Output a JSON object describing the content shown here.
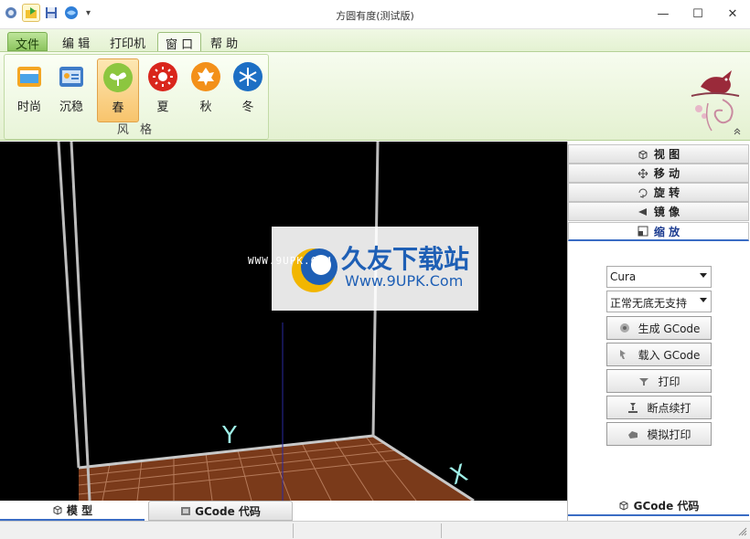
{
  "window": {
    "title": "方圆有度(测试版)",
    "minimize": "—",
    "maximize": "☐",
    "close": "✕"
  },
  "qat": {
    "customize": "▾"
  },
  "ribbon_tabs": [
    "文件",
    "编 辑",
    "打印机",
    "窗 口",
    "帮 助"
  ],
  "style_group": {
    "label": "风 格",
    "buttons": [
      "时尚",
      "沉稳",
      "春",
      "夏",
      "秋",
      "冬"
    ],
    "selected": "春"
  },
  "viewport": {
    "axis_y": "Y",
    "axis_x": "X",
    "watermark_url": "WWW.9UPK.COM",
    "watermark_brand": "久友下载站",
    "watermark_site": "Www.9UPK.Com"
  },
  "bottom_tabs": [
    "模 型",
    "GCode 代码"
  ],
  "right_panel": {
    "tabs": [
      "视 图",
      "移 动",
      "旋 转",
      "镜 像",
      "缩 放"
    ],
    "active_tab": "缩 放",
    "slicer_select": "Cura",
    "support_select": "正常无底无支持",
    "actions": [
      "生成 GCode",
      "载入 GCode",
      "打印",
      "断点续打",
      "模拟打印"
    ],
    "bottom_tab": "GCode 代码"
  },
  "colors": {
    "ribbon_green": "#e4f1d1",
    "selected_orange": "#f8c46c",
    "bed_brown": "#7a3a1a",
    "accent_blue": "#1a3a8f"
  }
}
